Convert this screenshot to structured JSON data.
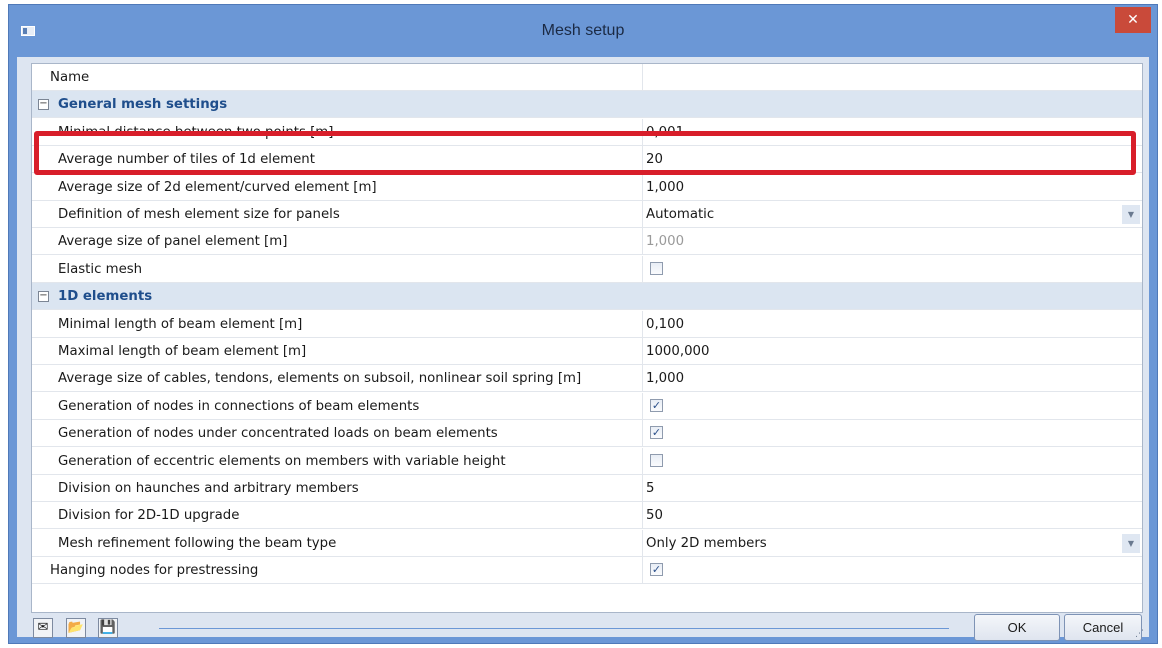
{
  "window": {
    "title": "Mesh setup",
    "close_glyph": "✕"
  },
  "header_row": {
    "label": "Name",
    "value": ""
  },
  "groups": [
    {
      "title": "General mesh settings",
      "rows": [
        {
          "label": "Minimal distance between two points [m]",
          "value": "0,001",
          "type": "text"
        },
        {
          "label": "Average number of tiles of 1d element",
          "value": "20",
          "type": "text"
        },
        {
          "label": "Average size of 2d element/curved element [m]",
          "value": "1,000",
          "type": "text"
        },
        {
          "label": "Definition of mesh element size for panels",
          "value": "Automatic",
          "type": "dropdown"
        },
        {
          "label": "Average size of panel element [m]",
          "value": "1,000",
          "type": "text-disabled"
        },
        {
          "label": "Elastic mesh",
          "value": "",
          "type": "checkbox",
          "checked": false
        }
      ]
    },
    {
      "title": "1D elements",
      "rows": [
        {
          "label": "Minimal length of beam element [m]",
          "value": "0,100",
          "type": "text"
        },
        {
          "label": "Maximal length of beam element [m]",
          "value": "1000,000",
          "type": "text"
        },
        {
          "label": "Average size of cables, tendons, elements on subsoil, nonlinear soil spring [m]",
          "value": "1,000",
          "type": "text"
        },
        {
          "label": "Generation of nodes in connections of beam elements",
          "value": "",
          "type": "checkbox",
          "checked": true
        },
        {
          "label": "Generation of nodes under concentrated loads on beam elements",
          "value": "",
          "type": "checkbox",
          "checked": true
        },
        {
          "label": "Generation of eccentric elements on members with variable height",
          "value": "",
          "type": "checkbox",
          "checked": false
        },
        {
          "label": "Division on haunches and arbitrary members",
          "value": "5",
          "type": "text"
        },
        {
          "label": "Division for 2D-1D upgrade",
          "value": "50",
          "type": "text"
        },
        {
          "label": "Mesh refinement following the beam type",
          "value": "Only 2D members",
          "type": "dropdown"
        }
      ]
    }
  ],
  "bottom_row": {
    "label": "Hanging nodes for prestressing",
    "value": "",
    "type": "checkbox",
    "checked": true
  },
  "toolbar": [
    {
      "name": "open-template-icon",
      "glyph": "✉"
    },
    {
      "name": "open-folder-icon",
      "glyph": "📂"
    },
    {
      "name": "save-icon",
      "glyph": "💾"
    }
  ],
  "buttons": {
    "ok": "OK",
    "cancel": "Cancel"
  },
  "glyphs": {
    "collapse": "−",
    "check": "✓",
    "dropdown": "▼",
    "grip": "⋰"
  },
  "colors": {
    "title_bar": "#6b97d6",
    "group_text": "#1f4e8c",
    "highlight": "#d81e2a"
  }
}
